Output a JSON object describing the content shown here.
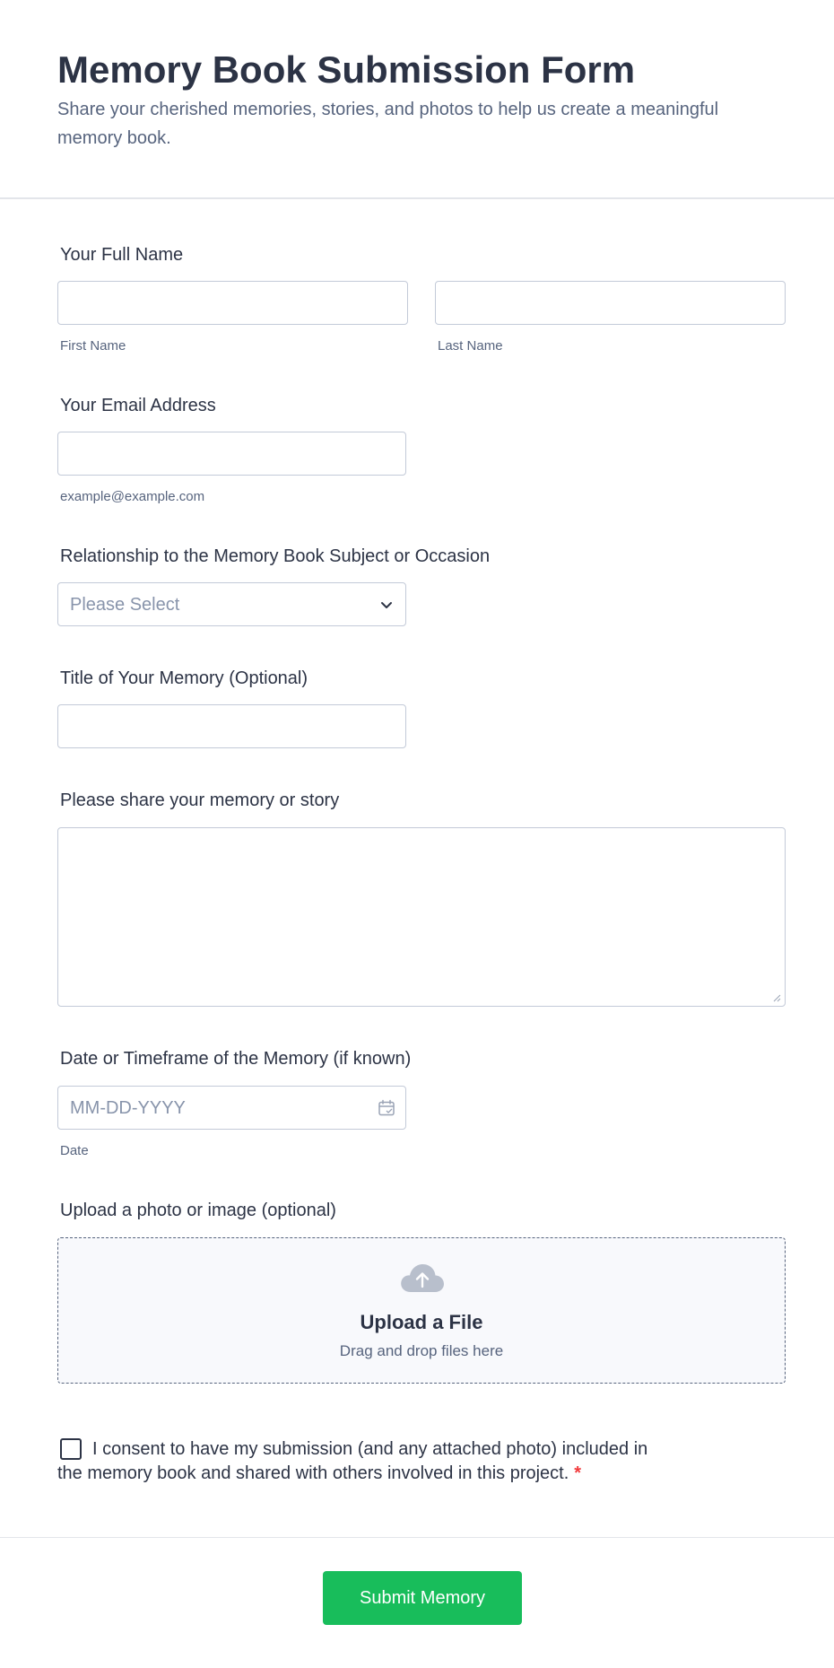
{
  "header": {
    "title": "Memory Book Submission Form",
    "subtitle": "Share your cherished memories, stories, and photos to help us create a meaningful memory book."
  },
  "fields": {
    "full_name": {
      "label": "Your Full Name",
      "first_sublabel": "First Name",
      "last_sublabel": "Last Name"
    },
    "email": {
      "label": "Your Email Address",
      "sublabel": "example@example.com"
    },
    "relationship": {
      "label": "Relationship to the Memory Book Subject or Occasion",
      "selected": "Please Select",
      "icon": "chevron-down-icon"
    },
    "memory_title": {
      "label": "Title of Your Memory (Optional)"
    },
    "memory_story": {
      "label": "Please share your memory or story"
    },
    "memory_date": {
      "label": "Date or Timeframe of the Memory (if known)",
      "placeholder": "MM-DD-YYYY",
      "sublabel": "Date",
      "icon": "calendar-icon"
    },
    "upload": {
      "label": "Upload a photo or image (optional)",
      "title": "Upload a File",
      "subtitle": "Drag and drop files here",
      "icon": "cloud-upload-icon"
    },
    "consent": {
      "line1": "I consent to have my submission (and any attached photo) included in",
      "line2": "the memory book and shared with others involved in this project.",
      "required_mark": "*"
    }
  },
  "submit": {
    "label": "Submit Memory"
  },
  "colors": {
    "text": "#2c3345",
    "muted": "#57647e",
    "border": "#c3cad8",
    "required": "#f23a3c",
    "submit_bg": "#18bd5b"
  }
}
